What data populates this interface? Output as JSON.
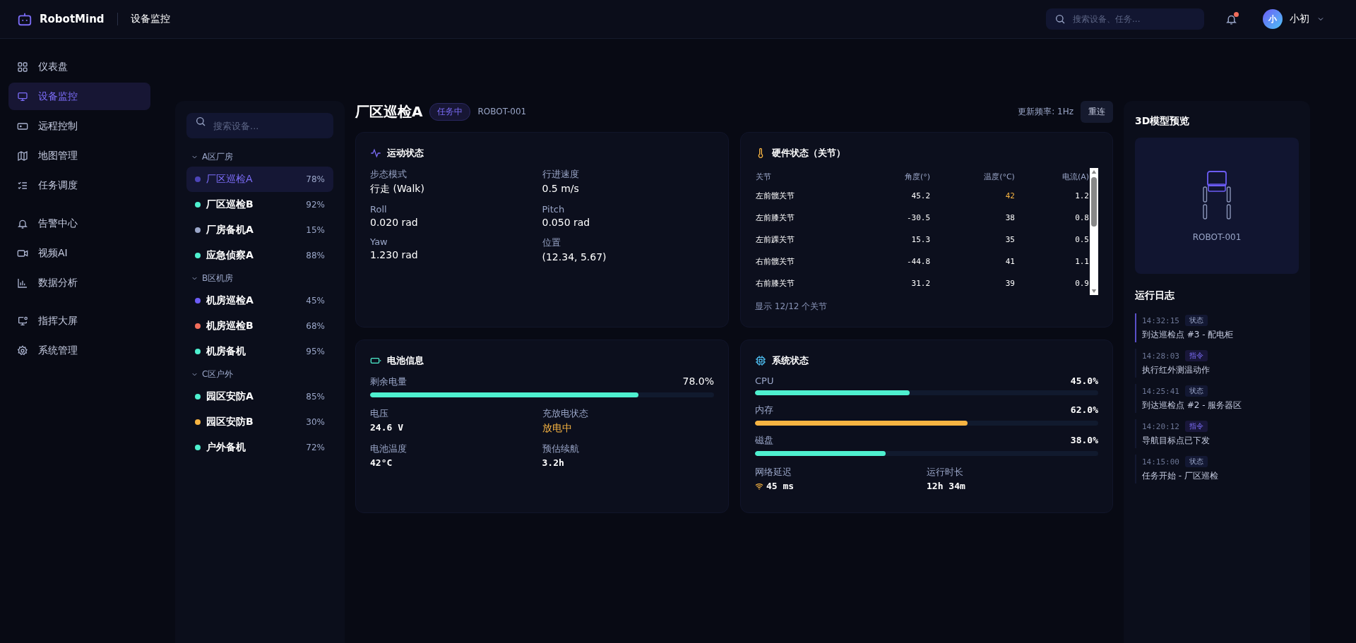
{
  "topbar": {
    "brand": "RobotMind",
    "page_title": "设备监控",
    "search": {
      "placeholder": "搜索设备、任务..."
    },
    "notification_dot": true,
    "user": {
      "avatar": "小",
      "name": "小初"
    }
  },
  "nav_groups": [
    [
      {
        "label": "仪表盘",
        "selected": false
      },
      {
        "label": "设备监控",
        "selected": true
      },
      {
        "label": "远程控制",
        "selected": false
      },
      {
        "label": "地图管理",
        "selected": false
      },
      {
        "label": "任务调度",
        "selected": false
      }
    ],
    [
      {
        "label": "告警中心",
        "selected": false
      },
      {
        "label": "视频AI",
        "selected": false
      },
      {
        "label": "数据分析",
        "selected": false
      }
    ],
    [
      {
        "label": "指挥大屏",
        "selected": false
      },
      {
        "label": "系统管理",
        "selected": false
      }
    ]
  ],
  "device_list": {
    "search": {
      "placeholder": "搜索设备..."
    },
    "groups": [
      {
        "name": "A区厂房",
        "expanded": true,
        "devices": [
          {
            "name": "厂区巡检A",
            "battery": "78%",
            "color": "#4c44b8",
            "selected": true
          },
          {
            "name": "厂区巡检B",
            "battery": "92%",
            "color": "#4ef0cf",
            "selected": false
          },
          {
            "name": "厂房备机A",
            "battery": "15%",
            "color": "#9aa6c8",
            "selected": false
          },
          {
            "name": "应急侦察A",
            "battery": "88%",
            "color": "#4ef0cf",
            "selected": false
          }
        ]
      },
      {
        "name": "B区机房",
        "expanded": true,
        "devices": [
          {
            "name": "机房巡检A",
            "battery": "45%",
            "color": "#6c5cf5",
            "selected": false
          },
          {
            "name": "机房巡检B",
            "battery": "68%",
            "color": "#f26d5b",
            "selected": false
          },
          {
            "name": "机房备机",
            "battery": "95%",
            "color": "#4ef0cf",
            "selected": false
          }
        ]
      },
      {
        "name": "C区户外",
        "expanded": true,
        "devices": [
          {
            "name": "园区安防A",
            "battery": "85%",
            "color": "#4ef0cf",
            "selected": false
          },
          {
            "name": "园区安防B",
            "battery": "30%",
            "color": "#f7b442",
            "selected": false
          },
          {
            "name": "户外备机",
            "battery": "72%",
            "color": "#4ef0cf",
            "selected": false
          }
        ]
      }
    ]
  },
  "device_header": {
    "name": "厂区巡检A",
    "status": "任务中",
    "id": "ROBOT-001",
    "update_rate": "更新频率: 1Hz",
    "reconnect": "重连"
  },
  "motion": {
    "title": "运动状态",
    "fields": [
      {
        "label": "步态模式",
        "value": "行走 (Walk)"
      },
      {
        "label": "行进速度",
        "value": "0.5 m/s"
      },
      {
        "label": "Roll",
        "value": "0.020 rad"
      },
      {
        "label": "Pitch",
        "value": "0.050 rad"
      },
      {
        "label": "Yaw",
        "value": "1.230 rad"
      },
      {
        "label": "位置",
        "value": "(12.34, 5.67)"
      }
    ]
  },
  "hardware": {
    "title": "硬件状态（关节）",
    "columns": [
      "关节",
      "角度(°)",
      "温度(°C)",
      "电流(A)"
    ],
    "rows": [
      {
        "joint": "左前髋关节",
        "angle": "45.2",
        "temp": "42",
        "temp_warn": true,
        "current": "1.2"
      },
      {
        "joint": "左前膝关节",
        "angle": "-30.5",
        "temp": "38",
        "temp_warn": false,
        "current": "0.8"
      },
      {
        "joint": "左前踝关节",
        "angle": "15.3",
        "temp": "35",
        "temp_warn": false,
        "current": "0.5"
      },
      {
        "joint": "右前髋关节",
        "angle": "-44.8",
        "temp": "41",
        "temp_warn": false,
        "current": "1.1"
      },
      {
        "joint": "右前膝关节",
        "angle": "31.2",
        "temp": "39",
        "temp_warn": false,
        "current": "0.9"
      }
    ],
    "footer": "显示 12/12 个关节"
  },
  "battery": {
    "title": "电池信息",
    "remaining": {
      "label": "剩余电量",
      "value": "78.0%",
      "level": 0.78
    },
    "fields": [
      {
        "label": "电压",
        "value": "24.6 V",
        "warn": false
      },
      {
        "label": "充放电状态",
        "value": "放电中",
        "warn": true
      },
      {
        "label": "电池温度",
        "value": "42°C",
        "warn": false
      },
      {
        "label": "预估续航",
        "value": "3.2h",
        "warn": false
      }
    ]
  },
  "system": {
    "title": "系统状态",
    "meters": [
      {
        "label": "CPU",
        "value": "45.0%",
        "level": 0.45,
        "color": "#4ef0cf"
      },
      {
        "label": "内存",
        "value": "62.0%",
        "level": 0.62,
        "color": "#f7b442"
      },
      {
        "label": "磁盘",
        "value": "38.0%",
        "level": 0.38,
        "color": "#4ef0cf"
      }
    ],
    "latency": {
      "label": "网络延迟",
      "value": "45 ms"
    },
    "uptime": {
      "label": "运行时长",
      "value": "12h 34m"
    }
  },
  "model_preview": {
    "title": "3D模型预览",
    "label": "ROBOT-001"
  },
  "log": {
    "title": "运行日志",
    "entries": [
      {
        "time": "14:32:15",
        "tag": "状态",
        "kind": "status",
        "text": "到达巡检点 #3 - 配电柜",
        "selected": true
      },
      {
        "time": "14:28:03",
        "tag": "指令",
        "kind": "command",
        "text": "执行红外测温动作",
        "selected": false
      },
      {
        "time": "14:25:41",
        "tag": "状态",
        "kind": "status",
        "text": "到达巡检点 #2 - 服务器区",
        "selected": false
      },
      {
        "time": "14:20:12",
        "tag": "指令",
        "kind": "command",
        "text": "导航目标点已下发",
        "selected": false
      },
      {
        "time": "14:15:00",
        "tag": "状态",
        "kind": "status",
        "text": "任务开始 - 厂区巡检",
        "selected": false
      }
    ]
  }
}
